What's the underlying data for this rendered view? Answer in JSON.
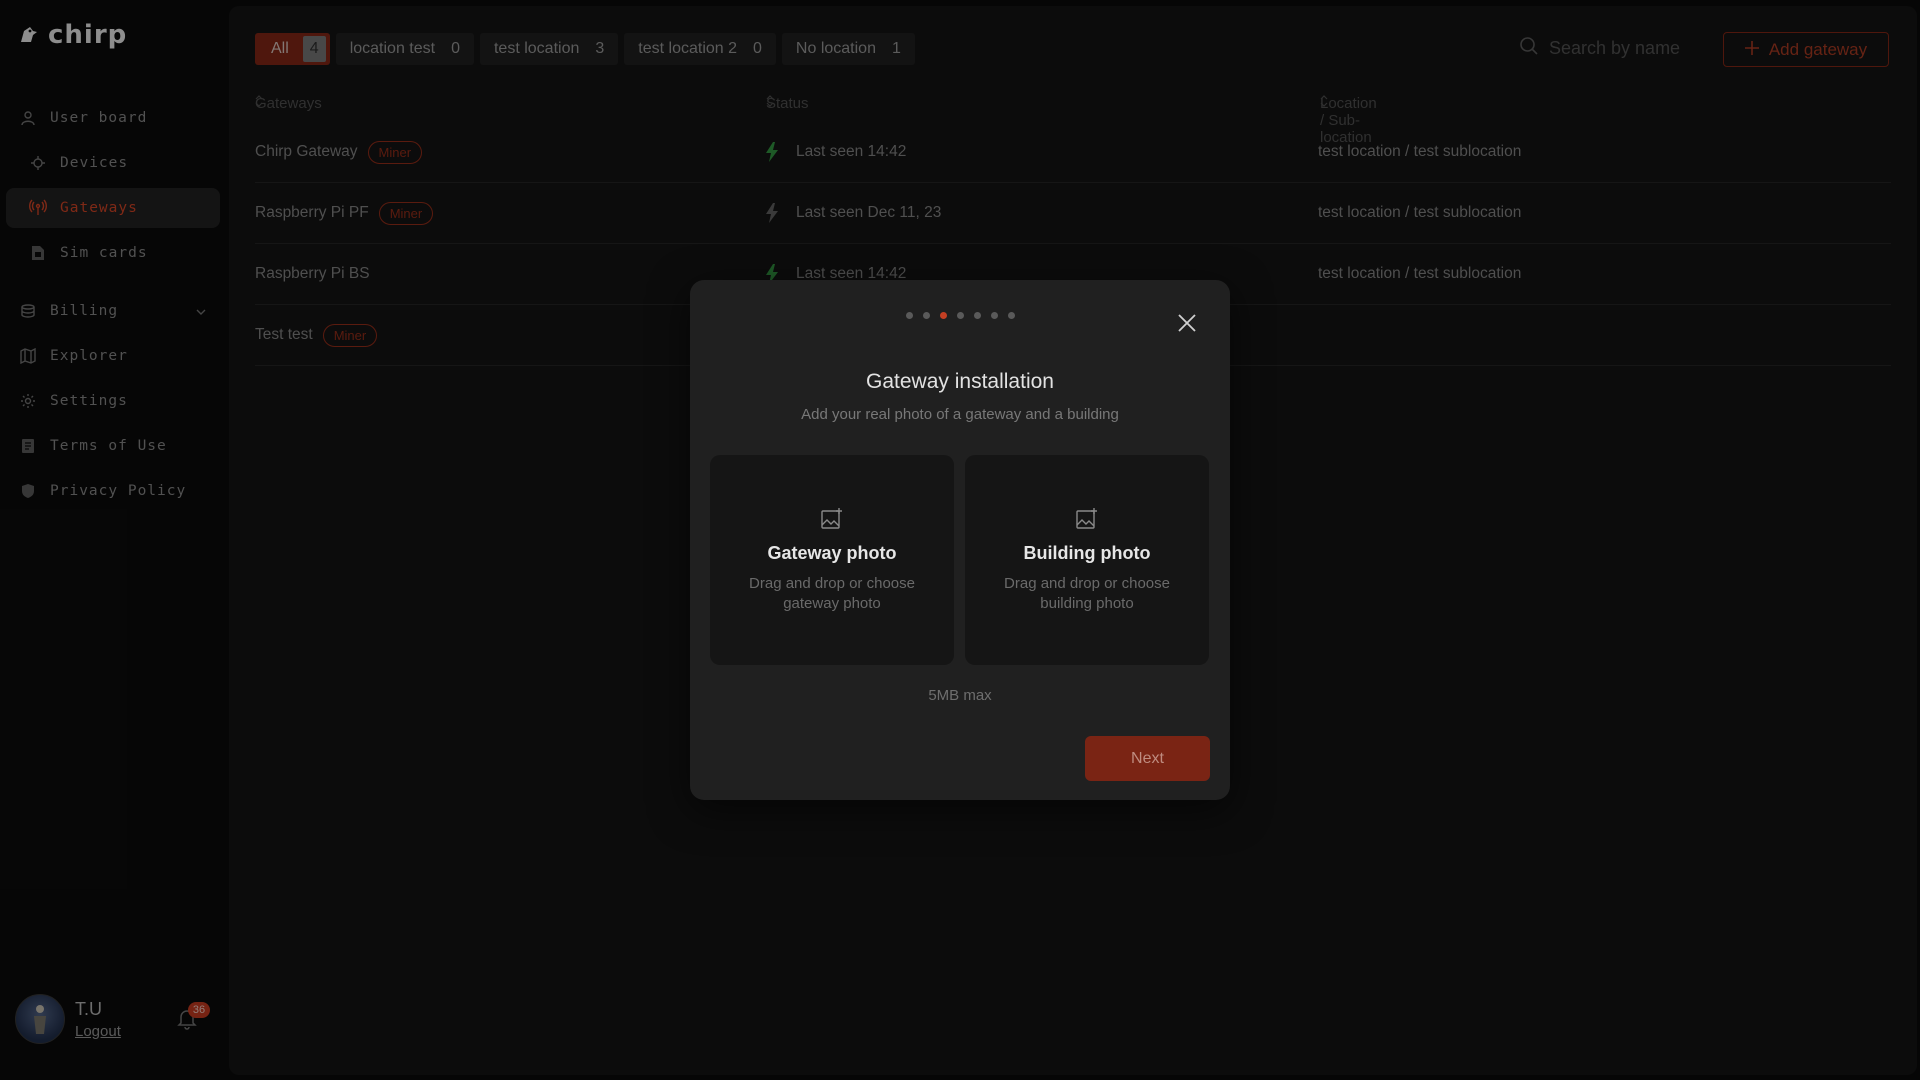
{
  "app": {
    "name": "chirp"
  },
  "sidebar": {
    "items": [
      {
        "label": "User board",
        "icon": "user-icon"
      },
      {
        "label": "Devices",
        "icon": "device-icon"
      },
      {
        "label": "Gateways",
        "icon": "antenna-icon",
        "active": true
      },
      {
        "label": "Sim cards",
        "icon": "sim-card-icon"
      },
      {
        "label": "Billing",
        "icon": "billing-icon"
      },
      {
        "label": "Explorer",
        "icon": "map-icon"
      },
      {
        "label": "Settings",
        "icon": "gear-icon"
      },
      {
        "label": "Terms of Use",
        "icon": "document-icon"
      },
      {
        "label": "Privacy Policy",
        "icon": "shield-icon"
      }
    ]
  },
  "user": {
    "name": "T.U",
    "logout": "Logout",
    "notifications": "36"
  },
  "filters": [
    {
      "label": "All",
      "count": "4",
      "active": true
    },
    {
      "label": "location test",
      "count": "0"
    },
    {
      "label": "test location",
      "count": "3"
    },
    {
      "label": "test location 2",
      "count": "0"
    },
    {
      "label": "No location",
      "count": "1"
    }
  ],
  "search": {
    "placeholder": "Search by name"
  },
  "add_button": "Add gateway",
  "table": {
    "headers": {
      "gateways": "Gateways",
      "status": "Status",
      "location": "Location / Sub-location"
    },
    "rows": [
      {
        "name": "Chirp Gateway",
        "badge": "Miner",
        "status": "Last seen 14:42",
        "online": true,
        "location": "test location / test sublocation"
      },
      {
        "name": "Raspberry Pi PF",
        "badge": "Miner",
        "status": "Last seen Dec 11, 23",
        "online": false,
        "location": "test location / test sublocation"
      },
      {
        "name": "Raspberry Pi BS",
        "badge": "",
        "status": "Last seen 14:42",
        "online": true,
        "location": "test location / test sublocation"
      },
      {
        "name": "Test test",
        "badge": "Miner",
        "status": "",
        "online": false,
        "location": ""
      }
    ]
  },
  "modal": {
    "step": 3,
    "total_steps": 7,
    "title": "Gateway installation",
    "subtitle": "Add your real photo of a gateway and a building",
    "gateway_photo": {
      "title": "Gateway photo",
      "desc": "Drag and drop or choose gateway photo"
    },
    "building_photo": {
      "title": "Building photo",
      "desc": "Drag and drop or choose building photo"
    },
    "max_size": "5MB max",
    "next": "Next"
  },
  "colors": {
    "accent": "#c43f23",
    "online": "#2f8a3c",
    "offline": "#5a5a5a"
  }
}
